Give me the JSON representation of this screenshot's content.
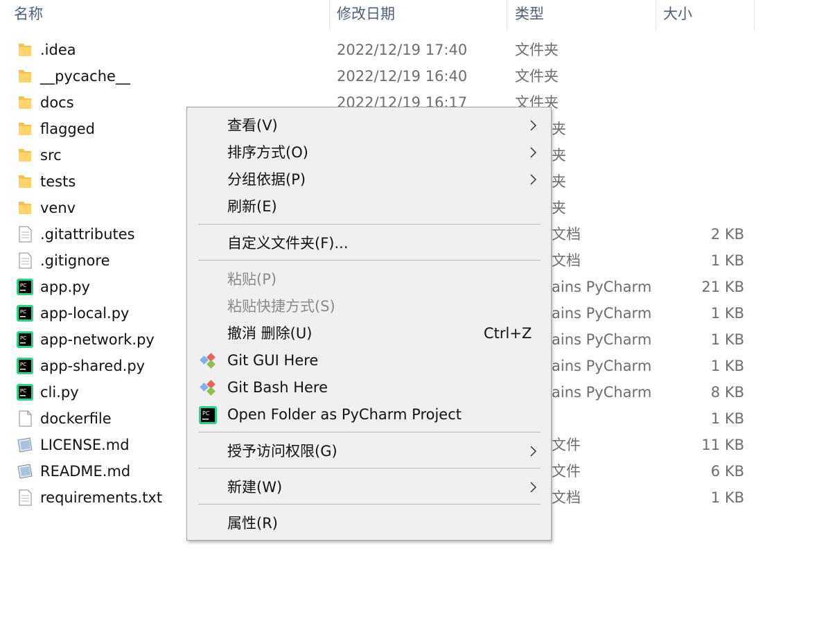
{
  "header": {
    "columns": [
      "名称",
      "修改日期",
      "类型",
      "大小"
    ]
  },
  "files": [
    {
      "name": ".idea",
      "date": "2022/12/19 17:40",
      "type": "文件夹",
      "size": "",
      "icon": "folder-icon"
    },
    {
      "name": "__pycache__",
      "date": "2022/12/19 16:40",
      "type": "文件夹",
      "size": "",
      "icon": "folder-icon"
    },
    {
      "name": "docs",
      "date": "2022/12/19 16:17",
      "type": "文件夹",
      "size": "",
      "icon": "folder-icon"
    },
    {
      "name": "flagged",
      "date": "",
      "type": "夹",
      "size": "",
      "icon": "folder-icon"
    },
    {
      "name": "src",
      "date": "",
      "type": "夹",
      "size": "",
      "icon": "folder-icon"
    },
    {
      "name": "tests",
      "date": "",
      "type": "夹",
      "size": "",
      "icon": "folder-icon"
    },
    {
      "name": "venv",
      "date": "",
      "type": "夹",
      "size": "",
      "icon": "folder-icon"
    },
    {
      "name": ".gitattributes",
      "date": "",
      "type": "文档",
      "size": "2 KB",
      "icon": "text-file-icon"
    },
    {
      "name": ".gitignore",
      "date": "",
      "type": "文档",
      "size": "1 KB",
      "icon": "text-file-icon"
    },
    {
      "name": "app.py",
      "date": "",
      "type": "ains PyCharm",
      "size": "21 KB",
      "icon": "pycharm-file-icon"
    },
    {
      "name": "app-local.py",
      "date": "",
      "type": "ains PyCharm",
      "size": "1 KB",
      "icon": "pycharm-file-icon"
    },
    {
      "name": "app-network.py",
      "date": "",
      "type": "ains PyCharm",
      "size": "1 KB",
      "icon": "pycharm-file-icon"
    },
    {
      "name": "app-shared.py",
      "date": "",
      "type": "ains PyCharm",
      "size": "1 KB",
      "icon": "pycharm-file-icon"
    },
    {
      "name": "cli.py",
      "date": "",
      "type": "ains PyCharm",
      "size": "8 KB",
      "icon": "pycharm-file-icon"
    },
    {
      "name": "dockerfile",
      "date": "",
      "type": "",
      "size": "1 KB",
      "icon": "blank-file-icon"
    },
    {
      "name": "LICENSE.md",
      "date": "",
      "type": "文件",
      "size": "11 KB",
      "icon": "markdown-file-icon"
    },
    {
      "name": "README.md",
      "date": "",
      "type": "文件",
      "size": "6 KB",
      "icon": "markdown-file-icon"
    },
    {
      "name": "requirements.txt",
      "date": "",
      "type": "文档",
      "size": "1 KB",
      "icon": "text-file-icon"
    }
  ],
  "context_menu": {
    "view": "查看(V)",
    "sort_by": "排序方式(O)",
    "group_by": "分组依据(P)",
    "refresh": "刷新(E)",
    "customize_folder": "自定义文件夹(F)...",
    "paste": "粘贴(P)",
    "paste_shortcut": "粘贴快捷方式(S)",
    "undo_delete": "撤消 删除(U)",
    "undo_shortcut": "Ctrl+Z",
    "git_gui": "Git GUI Here",
    "git_bash": "Git Bash Here",
    "open_pycharm": "Open Folder as PyCharm Project",
    "give_access": "授予访问权限(G)",
    "new": "新建(W)",
    "properties": "属性(R)"
  },
  "colors": {
    "folder": "#f2c14e",
    "menu_bg": "#f0f0f0",
    "header_text": "#4c607a",
    "disabled_text": "#8a8a8a"
  }
}
